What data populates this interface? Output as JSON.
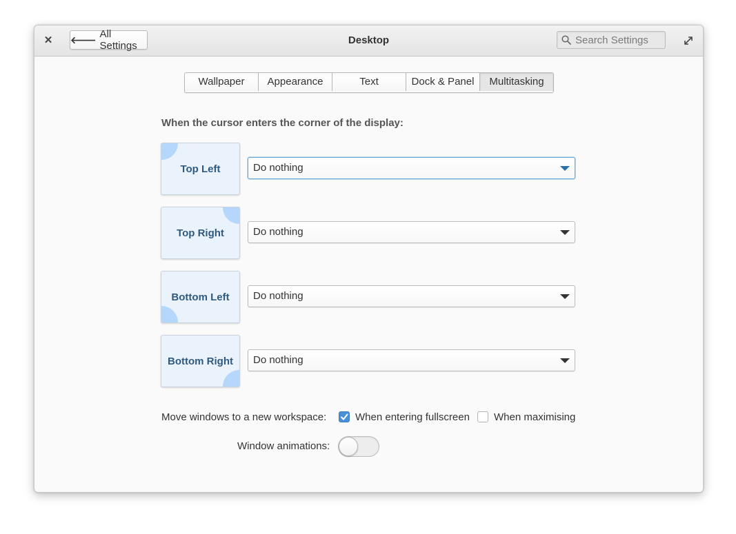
{
  "window": {
    "title": "Desktop",
    "back_label": "All Settings",
    "search_placeholder": "Search Settings"
  },
  "tabs": [
    {
      "label": "Wallpaper",
      "active": false
    },
    {
      "label": "Appearance",
      "active": false
    },
    {
      "label": "Text",
      "active": false
    },
    {
      "label": "Dock & Panel",
      "active": false
    },
    {
      "label": "Multitasking",
      "active": true
    }
  ],
  "hot_corners": {
    "heading": "When the cursor enters the corner of the display:",
    "corners": [
      {
        "label": "Top Left",
        "value": "Do nothing",
        "focused": true
      },
      {
        "label": "Top Right",
        "value": "Do nothing",
        "focused": false
      },
      {
        "label": "Bottom Left",
        "value": "Do nothing",
        "focused": false
      },
      {
        "label": "Bottom Right",
        "value": "Do nothing",
        "focused": false
      }
    ]
  },
  "workspace": {
    "label": "Move windows to a new workspace:",
    "fullscreen": {
      "label": "When entering fullscreen",
      "checked": true
    },
    "maximising": {
      "label": "When maximising",
      "checked": false
    }
  },
  "animations": {
    "label": "Window animations:",
    "enabled": false
  },
  "colors": {
    "accent": "#4a90d9",
    "tile_background": "#eaf2fc",
    "tile_corner": "#b4d7fb",
    "tile_text": "#2f5a80"
  }
}
